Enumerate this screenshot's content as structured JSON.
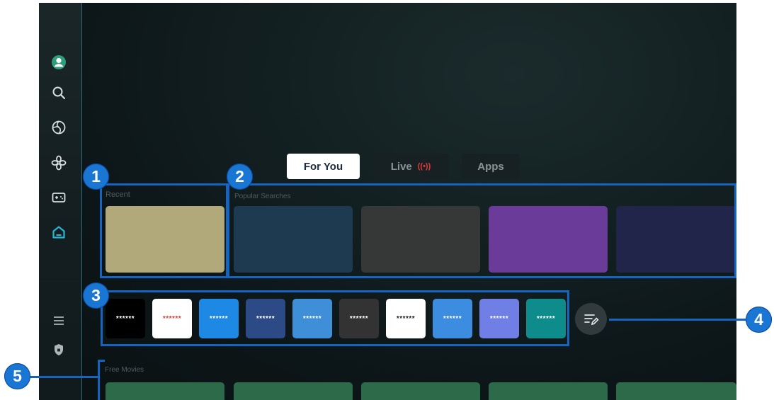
{
  "tabs": [
    {
      "label": "For You",
      "active": true
    },
    {
      "label": "Live",
      "active": false,
      "indicator": "((•))"
    },
    {
      "label": "Apps",
      "active": false
    }
  ],
  "sidebar": {
    "icons": [
      "profile-icon",
      "search-icon",
      "ambient-icon",
      "connected-devices-icon",
      "game-icon",
      "home-icon",
      "menu-icon",
      "privacy-shield-icon"
    ]
  },
  "sections": {
    "recent": {
      "label": "Recent"
    },
    "popular": {
      "label": "Popular Searches"
    },
    "free_movies": {
      "label": "Free Movies"
    }
  },
  "apps": [
    {
      "label": "******",
      "bg": "#000000",
      "fg": "#ffffff"
    },
    {
      "label": "******",
      "bg": "#ffffff",
      "fg": "#e53935"
    },
    {
      "label": "******",
      "bg": "#1e88e5",
      "fg": "#ffffff"
    },
    {
      "label": "******",
      "bg": "#2c4a86",
      "fg": "#ffffff"
    },
    {
      "label": "******",
      "bg": "#3f8fd8",
      "fg": "#ffffff"
    },
    {
      "label": "******",
      "bg": "#333333",
      "fg": "#ffffff"
    },
    {
      "label": "******",
      "bg": "#ffffff",
      "fg": "#222222"
    },
    {
      "label": "******",
      "bg": "#3c8ce0",
      "fg": "#ffffff"
    },
    {
      "label": "******",
      "bg": "#6f7fe6",
      "fg": "#ffffff"
    },
    {
      "label": "******",
      "bg": "#0e8c8c",
      "fg": "#ffffff"
    }
  ],
  "callouts": [
    "1",
    "2",
    "3",
    "4",
    "5"
  ],
  "colors": {
    "accent": "#1565c0",
    "callout": "#1976d2",
    "active_tab": "#ffffff",
    "home_icon": "#25b7d3"
  }
}
